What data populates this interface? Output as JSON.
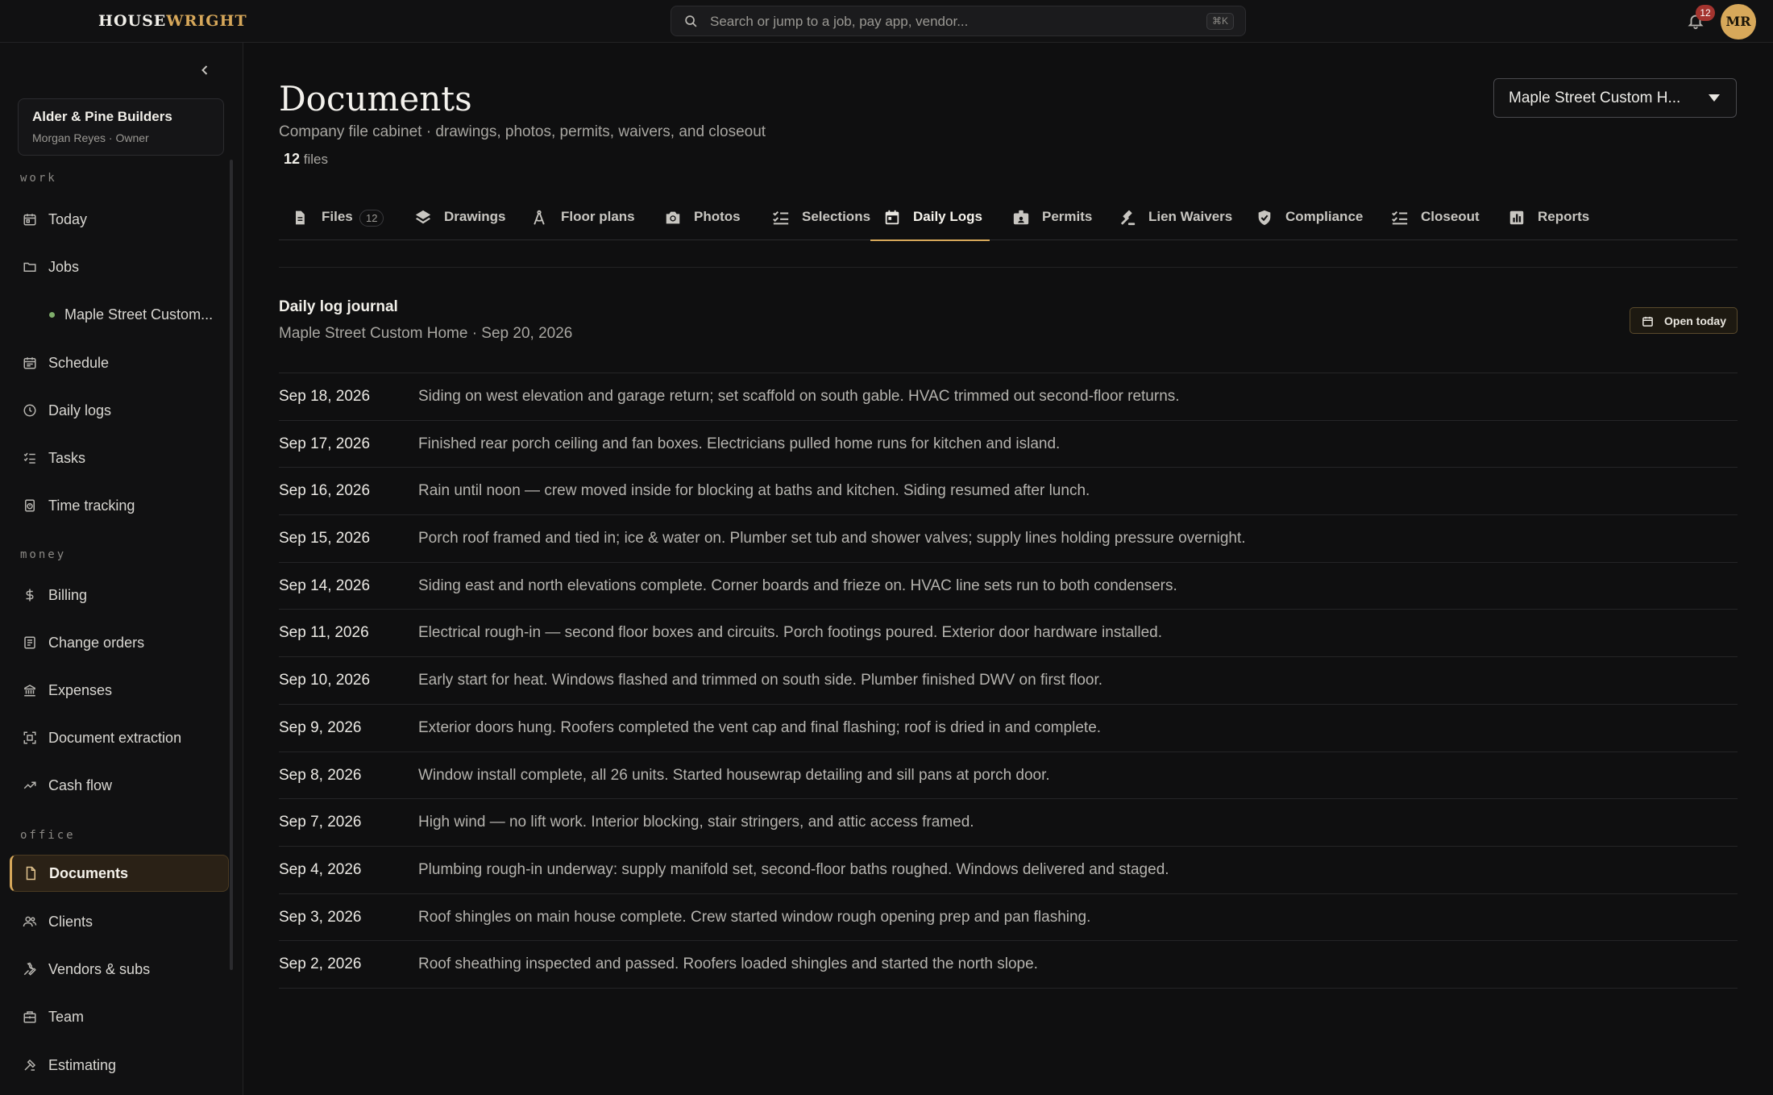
{
  "brand": {
    "logo_main": "HOUSE",
    "logo_accent": "WRIGHT",
    "accent_color": "#d7a85a"
  },
  "search": {
    "placeholder": "Search or jump to a job, pay app, vendor...",
    "shortcut": "⌘K"
  },
  "notifications": {
    "count": "12",
    "icon": "bell-icon"
  },
  "user": {
    "initials": "MR"
  },
  "org": {
    "name": "Alder & Pine Builders",
    "user_line": "Morgan Reyes · Owner"
  },
  "sidebar": {
    "sections": {
      "work": "work",
      "money": "money",
      "office": "office"
    },
    "items": [
      {
        "label": "Today",
        "icon": "calendar-icon"
      },
      {
        "label": "Jobs",
        "icon": "folder-icon"
      },
      {
        "label": "Maple Street Custom...",
        "icon": "dot"
      },
      {
        "label": "Schedule",
        "icon": "calendar-grid-icon"
      },
      {
        "label": "Daily logs",
        "icon": "clock-icon"
      },
      {
        "label": "Tasks",
        "icon": "checklist-icon"
      },
      {
        "label": "Time tracking",
        "icon": "timer-icon"
      },
      {
        "label": "Billing",
        "icon": "dollar-icon"
      },
      {
        "label": "Change orders",
        "icon": "clipboard-icon"
      },
      {
        "label": "Expenses",
        "icon": "bank-icon"
      },
      {
        "label": "Document extraction",
        "icon": "scan-icon"
      },
      {
        "label": "Cash flow",
        "icon": "trend-icon"
      },
      {
        "label": "Documents",
        "icon": "document-icon"
      },
      {
        "label": "Clients",
        "icon": "users-icon"
      },
      {
        "label": "Vendors & subs",
        "icon": "wrench-icon"
      },
      {
        "label": "Team",
        "icon": "building-icon"
      },
      {
        "label": "Estimating",
        "icon": "tools-icon"
      }
    ]
  },
  "page": {
    "title": "Documents",
    "subtitle": "Company file cabinet · drawings, photos, permits, waivers, and closeout",
    "file_count": "12",
    "file_count_label": "files",
    "job_selector": "Maple Street Custom H..."
  },
  "tabs": [
    {
      "label": "Files",
      "count": "12",
      "icon": "file-icon"
    },
    {
      "label": "Drawings",
      "icon": "layers-icon"
    },
    {
      "label": "Floor plans",
      "icon": "compass-icon"
    },
    {
      "label": "Photos",
      "icon": "camera-icon"
    },
    {
      "label": "Selections",
      "icon": "checklist-icon"
    },
    {
      "label": "Daily Logs",
      "icon": "calendar-icon",
      "active": true
    },
    {
      "label": "Permits",
      "icon": "badge-icon"
    },
    {
      "label": "Lien Waivers",
      "icon": "gavel-icon"
    },
    {
      "label": "Compliance",
      "icon": "shield-icon"
    },
    {
      "label": "Closeout",
      "icon": "checklist-icon"
    },
    {
      "label": "Reports",
      "icon": "bar-chart-icon"
    }
  ],
  "journal": {
    "title": "Daily log journal",
    "subtitle": "Maple Street Custom Home · Sep 20, 2026",
    "open_today": "Open today",
    "entries": [
      {
        "date": "Sep 18, 2026",
        "text": "Siding on west elevation and garage return; set scaffold on south gable. HVAC trimmed out second-floor returns."
      },
      {
        "date": "Sep 17, 2026",
        "text": "Finished rear porch ceiling and fan boxes. Electricians pulled home runs for kitchen and island."
      },
      {
        "date": "Sep 16, 2026",
        "text": "Rain until noon — crew moved inside for blocking at baths and kitchen. Siding resumed after lunch."
      },
      {
        "date": "Sep 15, 2026",
        "text": "Porch roof framed and tied in; ice & water on. Plumber set tub and shower valves; supply lines holding pressure overnight."
      },
      {
        "date": "Sep 14, 2026",
        "text": "Siding east and north elevations complete. Corner boards and frieze on. HVAC line sets run to both condensers."
      },
      {
        "date": "Sep 11, 2026",
        "text": "Electrical rough-in — second floor boxes and circuits. Porch footings poured. Exterior door hardware installed."
      },
      {
        "date": "Sep 10, 2026",
        "text": "Early start for heat. Windows flashed and trimmed on south side. Plumber finished DWV on first floor."
      },
      {
        "date": "Sep 9, 2026",
        "text": "Exterior doors hung. Roofers completed the vent cap and final flashing; roof is dried in and complete."
      },
      {
        "date": "Sep 8, 2026",
        "text": "Window install complete, all 26 units. Started housewrap detailing and sill pans at porch door."
      },
      {
        "date": "Sep 7, 2026",
        "text": "High wind — no lift work. Interior blocking, stair stringers, and attic access framed."
      },
      {
        "date": "Sep 4, 2026",
        "text": "Plumbing rough-in underway: supply manifold set, second-floor baths roughed. Windows delivered and staged."
      },
      {
        "date": "Sep 3, 2026",
        "text": "Roof shingles on main house complete. Crew started window rough opening prep and pan flashing."
      },
      {
        "date": "Sep 2, 2026",
        "text": "Roof sheathing inspected and passed. Roofers loaded shingles and started the north slope."
      }
    ]
  }
}
